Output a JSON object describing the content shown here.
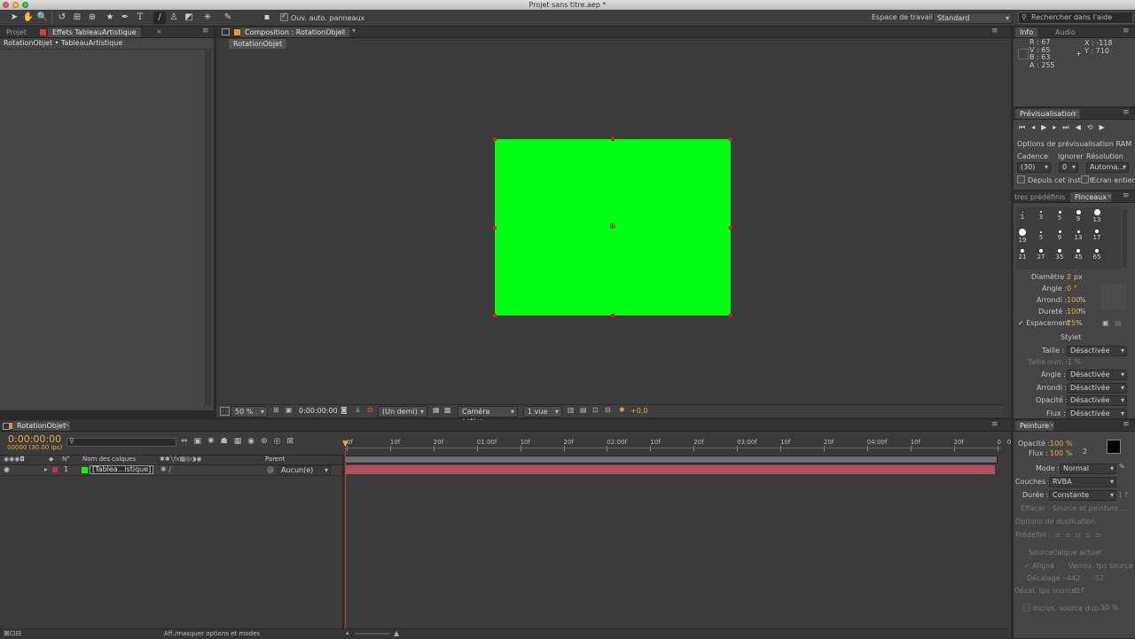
{
  "window": {
    "title": "Projet sans titre.aep *"
  },
  "toolbar": {
    "auto_open_label": "Ouv. auto. panneaux",
    "workspace_label": "Espace de travail :",
    "workspace_value": "Standard",
    "help_search_placeholder": "Rechercher dans l'aide"
  },
  "project_panel": {
    "tabs": [
      "Projet",
      "Effets TableauArtistique"
    ],
    "breadcrumb": "RotationObjet • TableauArtistique"
  },
  "composition_panel": {
    "tab": "Composition : RotationObjet",
    "subtab": "RotationObjet",
    "solid_color": "#00ff12",
    "footer": {
      "zoom": "50 %",
      "timecode": "0:00:00:00",
      "resolution": "(Un demi)",
      "camera": "Caméra active",
      "views": "1 vue",
      "exposure": "+0,0"
    }
  },
  "info_panel": {
    "tabs": [
      "Info",
      "Audio"
    ],
    "r": "R : 67",
    "v": "V : 65",
    "b": "B : 63",
    "a": "A : 255",
    "x": "X : -118",
    "y": "Y : 710"
  },
  "preview_panel": {
    "tab": "Prévisualisation",
    "ram_options": "Options de prévisualisation RAM",
    "cadence_label": "Cadence",
    "ignore_label": "Ignorer",
    "resolution_label": "Résolution",
    "cadence_value": "(30)",
    "ignore_value": "0",
    "resolution_value": "Automa...",
    "from_current": "Depuis cet instant",
    "full_screen": "Ecran entier"
  },
  "brushes_panel": {
    "tabs": [
      "tres prédéfinis",
      "Pinceaux"
    ],
    "sizes": [
      "1",
      "3",
      "5",
      "9",
      "13",
      "19",
      "5",
      "9",
      "13",
      "17",
      "21",
      "27",
      "35",
      "45",
      "65"
    ],
    "diameter_label": "Diamètre :",
    "diameter_value": "2",
    "diameter_unit": "px",
    "angle_label": "Angle :",
    "angle_value": "0 °",
    "roundness_label": "Arrondi :",
    "roundness_value": "100",
    "hardness_label": "Dureté :",
    "hardness_value": "100",
    "spacing_label": "Espacement",
    "spacing_value": "25",
    "percent": "%",
    "stylus_label": "Stylet",
    "size_label": "Taille :",
    "size_value": "Désactivée",
    "min_size_label": "Taille min. :",
    "min_size_value": "1 %",
    "angle2_label": "Angle :",
    "angle2_value": "Désactivée",
    "roundness2_label": "Arrondi :",
    "roundness2_value": "Désactivée",
    "opacity_label": "Opacité :",
    "opacity_value": "Désactivée",
    "flow_label": "Flux :",
    "flow_value": "Désactivée"
  },
  "paint_panel": {
    "tab": "Peinture",
    "opacity_label": "Opacité :",
    "opacity_value": "100 %",
    "flow_label": "Flux :",
    "flow_value": "100 %",
    "brush_size": "2",
    "mode_label": "Mode :",
    "mode_value": "Normal",
    "channels_label": "Couches :",
    "channels_value": "RVBA",
    "duration_label": "Durée :",
    "duration_value": "Constante",
    "duration_frames": "1 f",
    "erase_label": "Effacer :",
    "erase_value": "Source et peinture ...",
    "clone_options": "Options de duplication",
    "preset_label": "Prédéfini :",
    "source_label": "Source :",
    "source_value": "Calque actuel",
    "aligned_label": "Aligné",
    "lock_source_label": "Verrou. tps source",
    "offset_label": "Décalage :",
    "offset_x": "-442",
    "offset_y": "-52",
    "source_time_label": "Décal. tps source :",
    "source_time_value": "0 f",
    "overlay_label": "Incrus. source dup. :",
    "overlay_value": "50 %"
  },
  "timeline": {
    "tab": "RotationObjet",
    "timecode": "0:00:00:00",
    "timecode_sub": "00000 (30.00 ips)",
    "col_num": "N°",
    "col_name": "Nom des calques",
    "col_parent": "Parent",
    "layer": {
      "num": "1",
      "name": "[Tablea...istique]",
      "parent": "Aucun(e)",
      "color": "#00ff12"
    },
    "ruler": [
      "0f",
      "10f",
      "20f",
      "01:00f",
      "10f",
      "20f",
      "02:00f",
      "10f",
      "20f",
      "03:00f",
      "10f",
      "20f",
      "04:00f",
      "10f",
      "20f",
      "05:0"
    ],
    "footer_toggle": "Aff./masquer options et modes"
  }
}
